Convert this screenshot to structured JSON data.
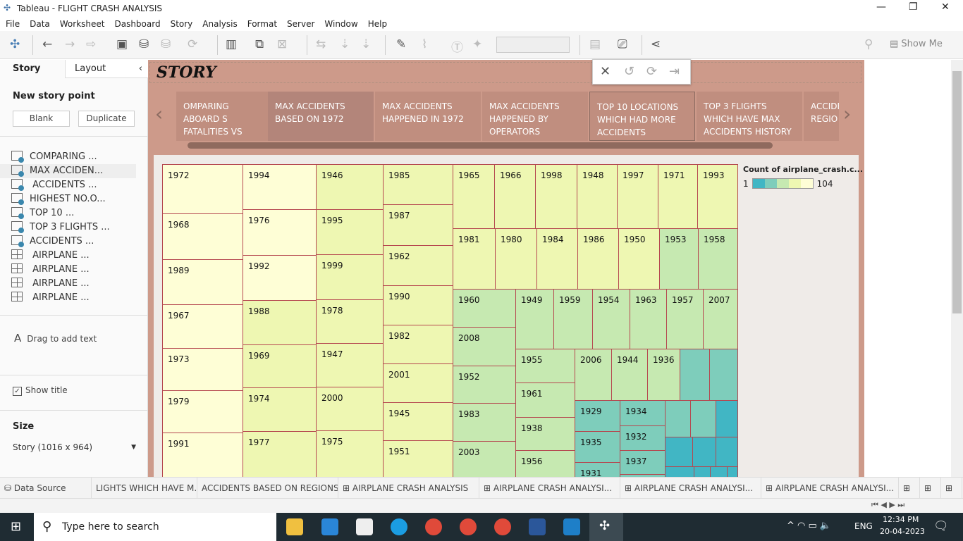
{
  "window": {
    "title": "Tableau - FLIGHT CRASH ANALYSIS"
  },
  "menu": [
    "File",
    "Data",
    "Worksheet",
    "Dashboard",
    "Story",
    "Analysis",
    "Format",
    "Server",
    "Window",
    "Help"
  ],
  "toolbar": {
    "show_me": "Show Me"
  },
  "left": {
    "tab_story": "Story",
    "tab_layout": "Layout",
    "new_point": "New story point",
    "blank": "Blank",
    "duplicate": "Duplicate",
    "points": [
      {
        "label": "COMPARING ...",
        "type": "sheet"
      },
      {
        "label": "MAX ACCIDEN...",
        "type": "sheet"
      },
      {
        "label": " ACCIDENTS ...",
        "type": "sheet"
      },
      {
        "label": "HIGHEST NO.O...",
        "type": "sheet"
      },
      {
        "label": "TOP 10 ...",
        "type": "sheet"
      },
      {
        "label": "TOP 3 FLIGHTS ...",
        "type": "sheet"
      },
      {
        "label": "ACCIDENTS ...",
        "type": "sheet"
      },
      {
        "label": " AIRPLANE ...",
        "type": "dashboard"
      },
      {
        "label": " AIRPLANE ...",
        "type": "dashboard"
      },
      {
        "label": " AIRPLANE ...",
        "type": "dashboard"
      },
      {
        "label": " AIRPLANE ...",
        "type": "dashboard"
      }
    ],
    "drag_text": "Drag to add text",
    "show_title": "Show title",
    "show_title_checked": true,
    "size_label": "Size",
    "size_value": "Story (1016 x 964)"
  },
  "story": {
    "title": "STORY",
    "nav": [
      "OMPARING ABOARD S FATALITIES VS ROUND",
      "MAX ACCIDENTS BASED ON 1972",
      "MAX ACCIDENTS HAPPENED IN 1972",
      "MAX ACCIDENTS HAPPENED BY OPERATORS",
      "TOP 10 LOCATIONS WHICH HAD MORE ACCIDENTS",
      "TOP 3 FLIGHTS WHICH HAVE MAX ACCIDENTS HISTORY",
      "ACCIDE REGIO"
    ],
    "selected": 1
  },
  "legend": {
    "title": "Count of airplane_crash.c...",
    "min": "1",
    "max": "104",
    "colors": [
      "#41b6c4",
      "#7ecdbb",
      "#c6e9b1",
      "#eef7b2",
      "#fefed6"
    ]
  },
  "treemap_colors": [
    "#fefed6",
    "#eef7b2",
    "#c6e9b1",
    "#7ecdbb",
    "#41b6c4"
  ],
  "treemap": [
    {
      "label": "1972",
      "level": 0
    },
    {
      "label": "1968",
      "level": 0
    },
    {
      "label": "1989",
      "level": 0
    },
    {
      "label": "1967",
      "level": 0
    },
    {
      "label": "1973",
      "level": 0
    },
    {
      "label": "1979",
      "level": 0
    },
    {
      "label": "1991",
      "level": 0
    },
    {
      "label": "1994",
      "level": 0
    },
    {
      "label": "1976",
      "level": 0
    },
    {
      "label": "1992",
      "level": 0
    },
    {
      "label": "1988",
      "level": 1
    },
    {
      "label": "1969",
      "level": 1
    },
    {
      "label": "1974",
      "level": 1
    },
    {
      "label": "1977",
      "level": 1
    },
    {
      "label": "1946",
      "level": 1
    },
    {
      "label": "1995",
      "level": 1
    },
    {
      "label": "1999",
      "level": 1
    },
    {
      "label": "1978",
      "level": 1
    },
    {
      "label": "1947",
      "level": 1
    },
    {
      "label": "2000",
      "level": 1
    },
    {
      "label": "1975",
      "level": 1
    },
    {
      "label": "1985",
      "level": 1
    },
    {
      "label": "1987",
      "level": 1
    },
    {
      "label": "1962",
      "level": 1
    },
    {
      "label": "1990",
      "level": 1
    },
    {
      "label": "1982",
      "level": 1
    },
    {
      "label": "2001",
      "level": 1
    },
    {
      "label": "1945",
      "level": 1
    },
    {
      "label": "1951",
      "level": 1
    },
    {
      "label": "1965",
      "level": 1
    },
    {
      "label": "1966",
      "level": 1
    },
    {
      "label": "1998",
      "level": 1
    },
    {
      "label": "1948",
      "level": 1
    },
    {
      "label": "1997",
      "level": 1
    },
    {
      "label": "1971",
      "level": 1
    },
    {
      "label": "1993",
      "level": 1
    },
    {
      "label": "1981",
      "level": 1
    },
    {
      "label": "1980",
      "level": 1
    },
    {
      "label": "1984",
      "level": 1
    },
    {
      "label": "1986",
      "level": 1
    },
    {
      "label": "1950",
      "level": 1
    },
    {
      "label": "1953",
      "level": 2
    },
    {
      "label": "1958",
      "level": 2
    },
    {
      "label": "1960",
      "level": 2
    },
    {
      "label": "2008",
      "level": 2
    },
    {
      "label": "1952",
      "level": 2
    },
    {
      "label": "1983",
      "level": 2
    },
    {
      "label": "2003",
      "level": 2
    },
    {
      "label": "1949",
      "level": 2
    },
    {
      "label": "1959",
      "level": 2
    },
    {
      "label": "1954",
      "level": 2
    },
    {
      "label": "1963",
      "level": 2
    },
    {
      "label": "1957",
      "level": 2
    },
    {
      "label": "2007",
      "level": 2
    },
    {
      "label": "1955",
      "level": 2
    },
    {
      "label": "1961",
      "level": 2
    },
    {
      "label": "1938",
      "level": 2
    },
    {
      "label": "1956",
      "level": 2
    },
    {
      "label": "2006",
      "level": 2
    },
    {
      "label": "1944",
      "level": 2
    },
    {
      "label": "1936",
      "level": 2
    },
    {
      "label": "",
      "level": 3
    },
    {
      "label": "",
      "level": 3
    },
    {
      "label": "1929",
      "level": 3
    },
    {
      "label": "1935",
      "level": 3
    },
    {
      "label": "1931",
      "level": 3
    },
    {
      "label": "1934",
      "level": 3
    },
    {
      "label": "1932",
      "level": 3
    },
    {
      "label": "1937",
      "level": 3
    },
    {
      "label": "",
      "level": 3
    },
    {
      "label": "",
      "level": 3
    },
    {
      "label": "",
      "level": 3
    },
    {
      "label": "",
      "level": 4
    },
    {
      "label": "",
      "level": 4
    },
    {
      "label": "",
      "level": 4
    },
    {
      "label": "",
      "level": 4
    },
    {
      "label": "",
      "level": 4
    },
    {
      "label": "",
      "level": 4
    },
    {
      "label": "",
      "level": 4
    },
    {
      "label": "",
      "level": 4
    }
  ],
  "sheet_tabs": [
    "Data Source",
    "LIGHTS WHICH HAVE M...",
    "ACCIDENTS BASED ON REGIONS",
    "AIRPLANE CRASH ANALYSIS",
    "AIRPLANE CRASH ANALYSI...",
    "AIRPLANE CRASH ANALYSI...",
    "AIRPLANE CRASH ANALYSI..."
  ],
  "taskbar": {
    "search_placeholder": "Type here to search",
    "lang": "ENG",
    "time": "12:34 PM",
    "date": "20-04-2023"
  }
}
